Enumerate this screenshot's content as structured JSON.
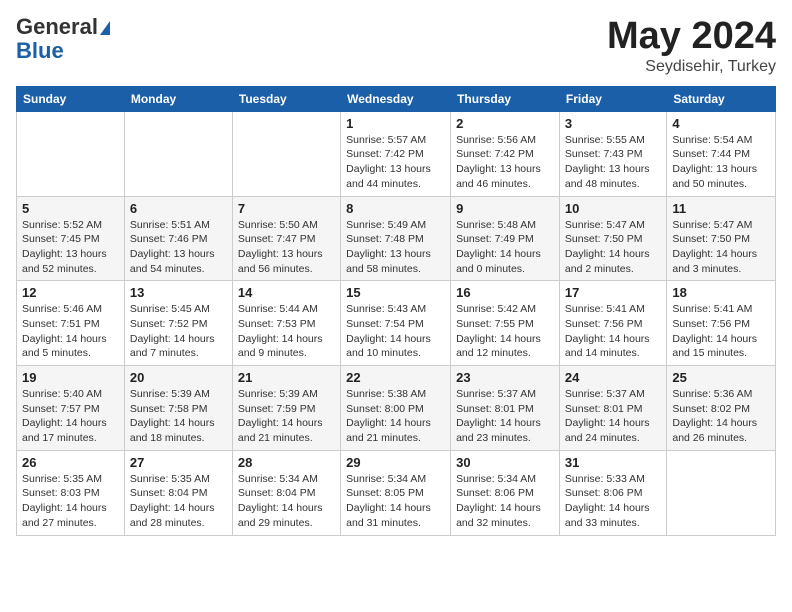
{
  "header": {
    "logo_general": "General",
    "logo_blue": "Blue",
    "title": "May 2024",
    "location": "Seydisehir, Turkey"
  },
  "days_of_week": [
    "Sunday",
    "Monday",
    "Tuesday",
    "Wednesday",
    "Thursday",
    "Friday",
    "Saturday"
  ],
  "weeks": [
    [
      {
        "day": "",
        "sunrise": "",
        "sunset": "",
        "daylight": ""
      },
      {
        "day": "",
        "sunrise": "",
        "sunset": "",
        "daylight": ""
      },
      {
        "day": "",
        "sunrise": "",
        "sunset": "",
        "daylight": ""
      },
      {
        "day": "1",
        "sunrise": "Sunrise: 5:57 AM",
        "sunset": "Sunset: 7:42 PM",
        "daylight": "Daylight: 13 hours and 44 minutes."
      },
      {
        "day": "2",
        "sunrise": "Sunrise: 5:56 AM",
        "sunset": "Sunset: 7:42 PM",
        "daylight": "Daylight: 13 hours and 46 minutes."
      },
      {
        "day": "3",
        "sunrise": "Sunrise: 5:55 AM",
        "sunset": "Sunset: 7:43 PM",
        "daylight": "Daylight: 13 hours and 48 minutes."
      },
      {
        "day": "4",
        "sunrise": "Sunrise: 5:54 AM",
        "sunset": "Sunset: 7:44 PM",
        "daylight": "Daylight: 13 hours and 50 minutes."
      }
    ],
    [
      {
        "day": "5",
        "sunrise": "Sunrise: 5:52 AM",
        "sunset": "Sunset: 7:45 PM",
        "daylight": "Daylight: 13 hours and 52 minutes."
      },
      {
        "day": "6",
        "sunrise": "Sunrise: 5:51 AM",
        "sunset": "Sunset: 7:46 PM",
        "daylight": "Daylight: 13 hours and 54 minutes."
      },
      {
        "day": "7",
        "sunrise": "Sunrise: 5:50 AM",
        "sunset": "Sunset: 7:47 PM",
        "daylight": "Daylight: 13 hours and 56 minutes."
      },
      {
        "day": "8",
        "sunrise": "Sunrise: 5:49 AM",
        "sunset": "Sunset: 7:48 PM",
        "daylight": "Daylight: 13 hours and 58 minutes."
      },
      {
        "day": "9",
        "sunrise": "Sunrise: 5:48 AM",
        "sunset": "Sunset: 7:49 PM",
        "daylight": "Daylight: 14 hours and 0 minutes."
      },
      {
        "day": "10",
        "sunrise": "Sunrise: 5:47 AM",
        "sunset": "Sunset: 7:50 PM",
        "daylight": "Daylight: 14 hours and 2 minutes."
      },
      {
        "day": "11",
        "sunrise": "Sunrise: 5:47 AM",
        "sunset": "Sunset: 7:50 PM",
        "daylight": "Daylight: 14 hours and 3 minutes."
      }
    ],
    [
      {
        "day": "12",
        "sunrise": "Sunrise: 5:46 AM",
        "sunset": "Sunset: 7:51 PM",
        "daylight": "Daylight: 14 hours and 5 minutes."
      },
      {
        "day": "13",
        "sunrise": "Sunrise: 5:45 AM",
        "sunset": "Sunset: 7:52 PM",
        "daylight": "Daylight: 14 hours and 7 minutes."
      },
      {
        "day": "14",
        "sunrise": "Sunrise: 5:44 AM",
        "sunset": "Sunset: 7:53 PM",
        "daylight": "Daylight: 14 hours and 9 minutes."
      },
      {
        "day": "15",
        "sunrise": "Sunrise: 5:43 AM",
        "sunset": "Sunset: 7:54 PM",
        "daylight": "Daylight: 14 hours and 10 minutes."
      },
      {
        "day": "16",
        "sunrise": "Sunrise: 5:42 AM",
        "sunset": "Sunset: 7:55 PM",
        "daylight": "Daylight: 14 hours and 12 minutes."
      },
      {
        "day": "17",
        "sunrise": "Sunrise: 5:41 AM",
        "sunset": "Sunset: 7:56 PM",
        "daylight": "Daylight: 14 hours and 14 minutes."
      },
      {
        "day": "18",
        "sunrise": "Sunrise: 5:41 AM",
        "sunset": "Sunset: 7:56 PM",
        "daylight": "Daylight: 14 hours and 15 minutes."
      }
    ],
    [
      {
        "day": "19",
        "sunrise": "Sunrise: 5:40 AM",
        "sunset": "Sunset: 7:57 PM",
        "daylight": "Daylight: 14 hours and 17 minutes."
      },
      {
        "day": "20",
        "sunrise": "Sunrise: 5:39 AM",
        "sunset": "Sunset: 7:58 PM",
        "daylight": "Daylight: 14 hours and 18 minutes."
      },
      {
        "day": "21",
        "sunrise": "Sunrise: 5:39 AM",
        "sunset": "Sunset: 7:59 PM",
        "daylight": "Daylight: 14 hours and 21 minutes."
      },
      {
        "day": "22",
        "sunrise": "Sunrise: 5:38 AM",
        "sunset": "Sunset: 8:00 PM",
        "daylight": "Daylight: 14 hours and 21 minutes."
      },
      {
        "day": "23",
        "sunrise": "Sunrise: 5:37 AM",
        "sunset": "Sunset: 8:01 PM",
        "daylight": "Daylight: 14 hours and 23 minutes."
      },
      {
        "day": "24",
        "sunrise": "Sunrise: 5:37 AM",
        "sunset": "Sunset: 8:01 PM",
        "daylight": "Daylight: 14 hours and 24 minutes."
      },
      {
        "day": "25",
        "sunrise": "Sunrise: 5:36 AM",
        "sunset": "Sunset: 8:02 PM",
        "daylight": "Daylight: 14 hours and 26 minutes."
      }
    ],
    [
      {
        "day": "26",
        "sunrise": "Sunrise: 5:35 AM",
        "sunset": "Sunset: 8:03 PM",
        "daylight": "Daylight: 14 hours and 27 minutes."
      },
      {
        "day": "27",
        "sunrise": "Sunrise: 5:35 AM",
        "sunset": "Sunset: 8:04 PM",
        "daylight": "Daylight: 14 hours and 28 minutes."
      },
      {
        "day": "28",
        "sunrise": "Sunrise: 5:34 AM",
        "sunset": "Sunset: 8:04 PM",
        "daylight": "Daylight: 14 hours and 29 minutes."
      },
      {
        "day": "29",
        "sunrise": "Sunrise: 5:34 AM",
        "sunset": "Sunset: 8:05 PM",
        "daylight": "Daylight: 14 hours and 31 minutes."
      },
      {
        "day": "30",
        "sunrise": "Sunrise: 5:34 AM",
        "sunset": "Sunset: 8:06 PM",
        "daylight": "Daylight: 14 hours and 32 minutes."
      },
      {
        "day": "31",
        "sunrise": "Sunrise: 5:33 AM",
        "sunset": "Sunset: 8:06 PM",
        "daylight": "Daylight: 14 hours and 33 minutes."
      },
      {
        "day": "",
        "sunrise": "",
        "sunset": "",
        "daylight": ""
      }
    ]
  ]
}
